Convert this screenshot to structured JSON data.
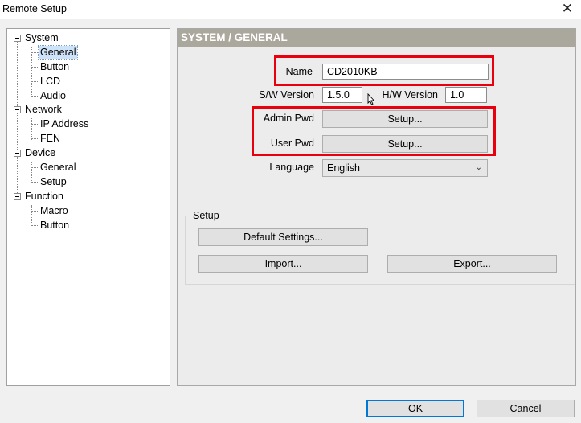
{
  "window": {
    "title": "Remote Setup",
    "close_glyph": "✕"
  },
  "tree": {
    "system": {
      "label": "System",
      "children": [
        "General",
        "Button",
        "LCD",
        "Audio"
      ]
    },
    "network": {
      "label": "Network",
      "children": [
        "IP Address",
        "FEN"
      ]
    },
    "device": {
      "label": "Device",
      "children": [
        "General",
        "Setup"
      ]
    },
    "function": {
      "label": "Function",
      "children": [
        "Macro",
        "Button"
      ]
    },
    "selected": "System / General"
  },
  "panel": {
    "header": "SYSTEM / GENERAL",
    "name_label": "Name",
    "name_value": "CD2010KB",
    "sw_label": "S/W Version",
    "sw_value": "1.5.0",
    "hw_label": "H/W Version",
    "hw_value": "1.0",
    "admin_label": "Admin Pwd",
    "admin_button": "Setup...",
    "user_label": "User Pwd",
    "user_button": "Setup...",
    "language_label": "Language",
    "language_value": "English",
    "setup_group": {
      "label": "Setup",
      "default_button": "Default Settings...",
      "import_button": "Import...",
      "export_button": "Export..."
    }
  },
  "footer": {
    "ok": "OK",
    "cancel": "Cancel"
  },
  "colors": {
    "highlight": "#e8000e",
    "header_bg": "#aaa79d",
    "accent": "#0078d7"
  }
}
